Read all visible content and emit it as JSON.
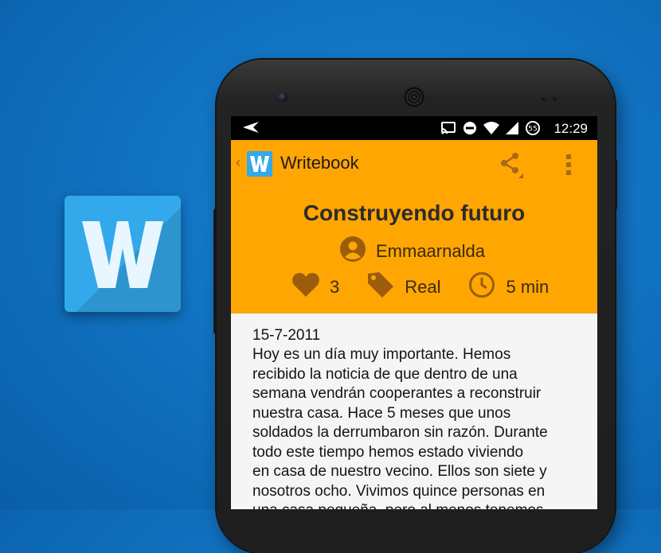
{
  "promo_logo": {
    "letter": "W",
    "color": "#33a8ea"
  },
  "statusbar": {
    "notification_icon": "send-icon",
    "icons": [
      "cast-icon",
      "do-not-disturb-icon",
      "wifi-icon",
      "signal-icon",
      "data-saver-icon"
    ],
    "time": "12:29"
  },
  "appbar": {
    "back_glyph": "‹",
    "logo_letter": "W",
    "title": "Writebook",
    "share_icon": "share-icon",
    "overflow_icon": "more-vert-icon",
    "color": "#ffa603"
  },
  "story": {
    "title": "Construyendo futuro",
    "author": "Emmaarnalda",
    "likes": "3",
    "tag": "Real",
    "read_time": "5 min",
    "date": "15-7-2011",
    "body": "Hoy es un día muy importante. Hemos\nrecibido la noticia de que dentro de una\nsemana vendrán cooperantes a reconstruir\nnuestra casa. Hace 5 meses que unos\nsoldados la derrumbaron sin razón. Durante\ntodo este tiempo hemos estado viviendo\nen casa de nuestro vecino. Ellos son siete y\nnosotros ocho. Vivimos quince personas en\nuna casa pequeña, pero al menos tenemos"
  }
}
